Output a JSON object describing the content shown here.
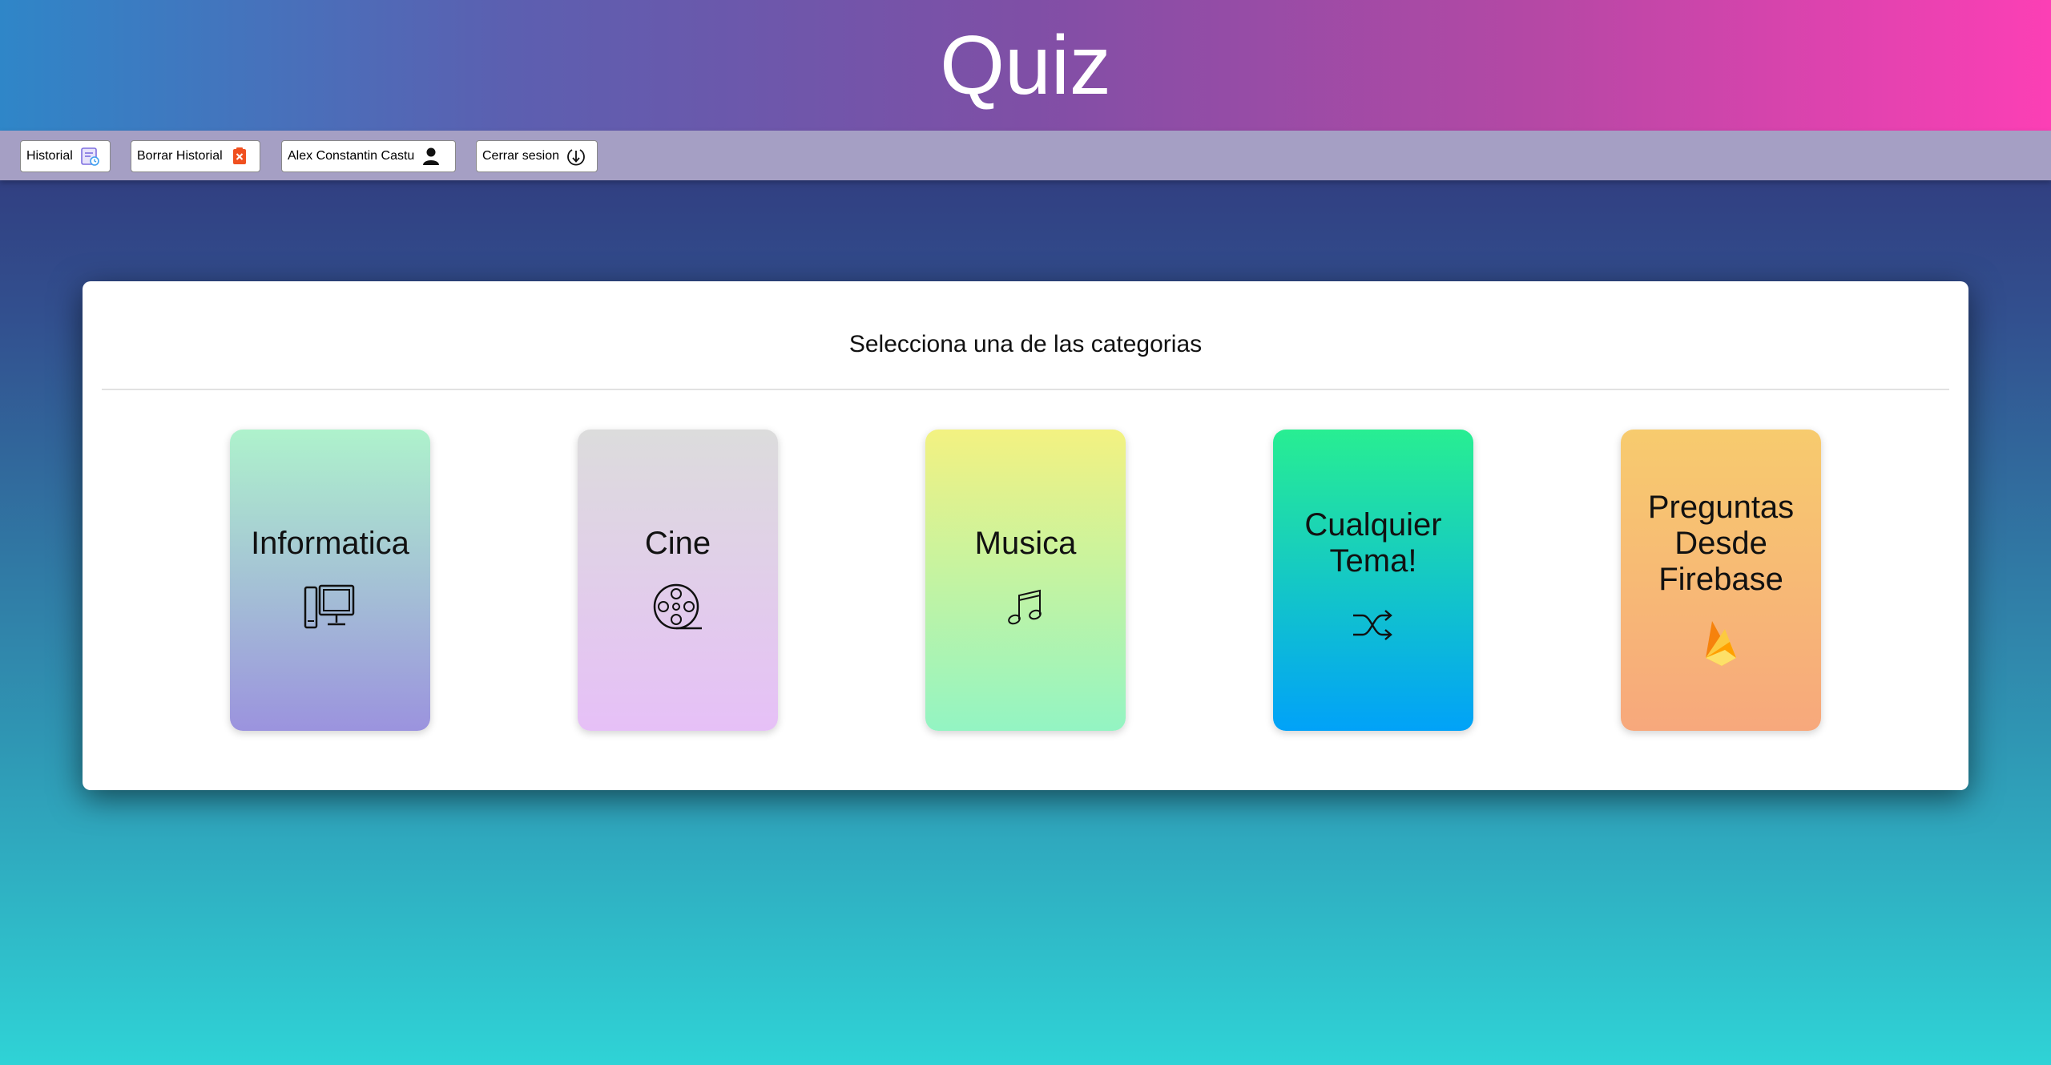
{
  "header": {
    "title": "Quiz"
  },
  "toolbar": {
    "history_label": "Historial",
    "clear_history_label": "Borrar Historial",
    "user_label": "Alex Constantin Castu",
    "logout_label": "Cerrar sesion"
  },
  "main": {
    "subtitle": "Selecciona una de las categorias",
    "categories": [
      {
        "label": "Informatica",
        "icon": "computer-icon"
      },
      {
        "label": "Cine",
        "icon": "film-reel-icon"
      },
      {
        "label": "Musica",
        "icon": "music-note-icon"
      },
      {
        "label": "Cualquier Tema!",
        "icon": "shuffle-icon"
      },
      {
        "label": "Preguntas Desde Firebase",
        "icon": "firebase-icon"
      }
    ]
  }
}
